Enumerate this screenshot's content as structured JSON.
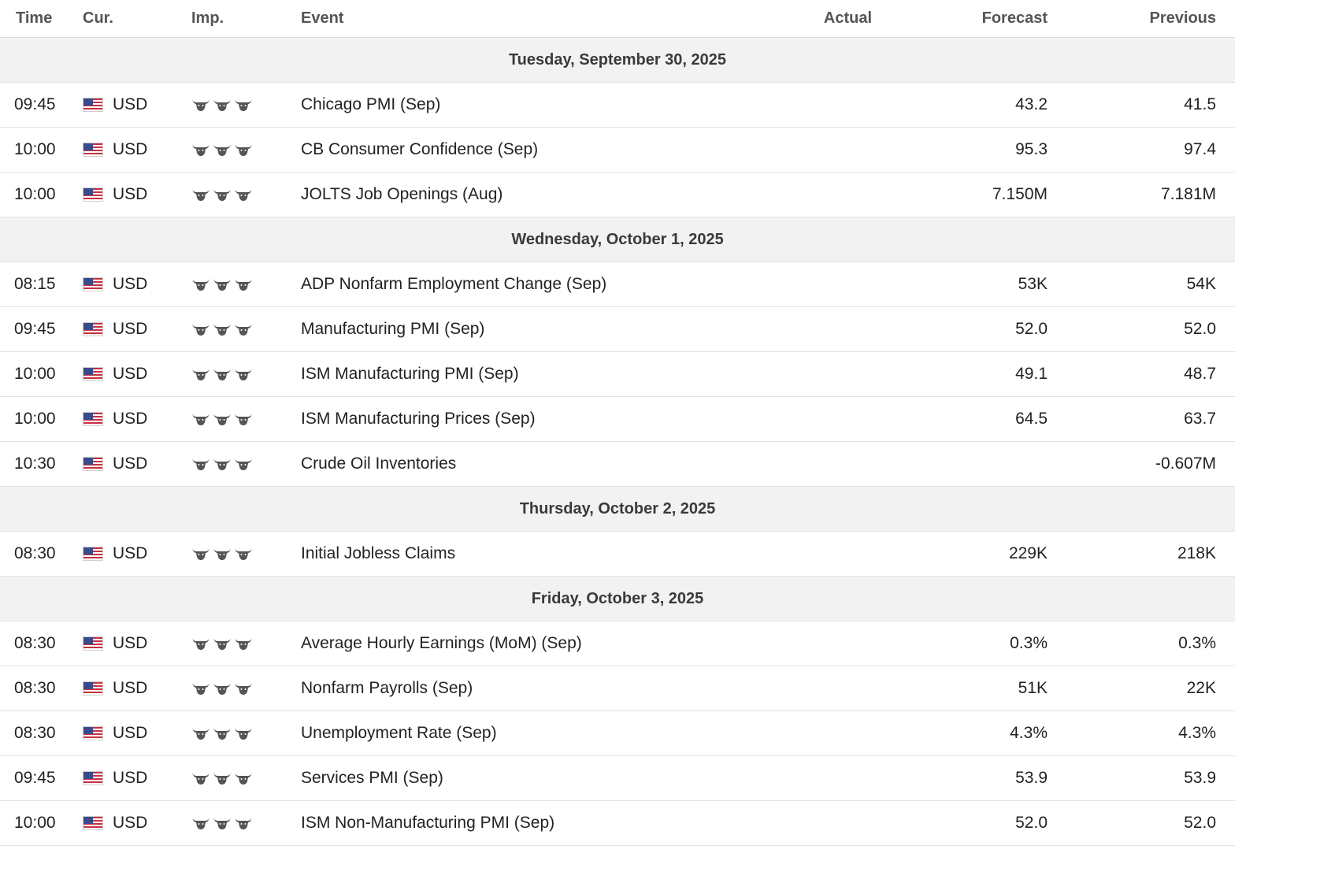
{
  "header": {
    "time": "Time",
    "currency": "Cur.",
    "importance": "Imp.",
    "event": "Event",
    "actual": "Actual",
    "forecast": "Forecast",
    "previous": "Previous"
  },
  "importance_icon": "bull-icon",
  "flag_icon": "us-flag-icon",
  "days": [
    {
      "date": "Tuesday, September 30, 2025",
      "events": [
        {
          "time": "09:45",
          "currency": "USD",
          "importance": 3,
          "event": "Chicago PMI (Sep)",
          "actual": "",
          "forecast": "43.2",
          "previous": "41.5"
        },
        {
          "time": "10:00",
          "currency": "USD",
          "importance": 3,
          "event": "CB Consumer Confidence (Sep)",
          "actual": "",
          "forecast": "95.3",
          "previous": "97.4"
        },
        {
          "time": "10:00",
          "currency": "USD",
          "importance": 3,
          "event": "JOLTS Job Openings (Aug)",
          "actual": "",
          "forecast": "7.150M",
          "previous": "7.181M"
        }
      ]
    },
    {
      "date": "Wednesday, October 1, 2025",
      "events": [
        {
          "time": "08:15",
          "currency": "USD",
          "importance": 3,
          "event": "ADP Nonfarm Employment Change (Sep)",
          "actual": "",
          "forecast": "53K",
          "previous": "54K"
        },
        {
          "time": "09:45",
          "currency": "USD",
          "importance": 3,
          "event": "Manufacturing PMI (Sep)",
          "actual": "",
          "forecast": "52.0",
          "previous": "52.0"
        },
        {
          "time": "10:00",
          "currency": "USD",
          "importance": 3,
          "event": "ISM Manufacturing PMI (Sep)",
          "actual": "",
          "forecast": "49.1",
          "previous": "48.7"
        },
        {
          "time": "10:00",
          "currency": "USD",
          "importance": 3,
          "event": "ISM Manufacturing Prices (Sep)",
          "actual": "",
          "forecast": "64.5",
          "previous": "63.7"
        },
        {
          "time": "10:30",
          "currency": "USD",
          "importance": 3,
          "event": "Crude Oil Inventories",
          "actual": "",
          "forecast": "",
          "previous": "-0.607M"
        }
      ]
    },
    {
      "date": "Thursday, October 2, 2025",
      "events": [
        {
          "time": "08:30",
          "currency": "USD",
          "importance": 3,
          "event": "Initial Jobless Claims",
          "actual": "",
          "forecast": "229K",
          "previous": "218K"
        }
      ]
    },
    {
      "date": "Friday, October 3, 2025",
      "events": [
        {
          "time": "08:30",
          "currency": "USD",
          "importance": 3,
          "event": "Average Hourly Earnings (MoM) (Sep)",
          "actual": "",
          "forecast": "0.3%",
          "previous": "0.3%"
        },
        {
          "time": "08:30",
          "currency": "USD",
          "importance": 3,
          "event": "Nonfarm Payrolls (Sep)",
          "actual": "",
          "forecast": "51K",
          "previous": "22K"
        },
        {
          "time": "08:30",
          "currency": "USD",
          "importance": 3,
          "event": "Unemployment Rate (Sep)",
          "actual": "",
          "forecast": "4.3%",
          "previous": "4.3%"
        },
        {
          "time": "09:45",
          "currency": "USD",
          "importance": 3,
          "event": "Services PMI (Sep)",
          "actual": "",
          "forecast": "53.9",
          "previous": "53.9"
        },
        {
          "time": "10:00",
          "currency": "USD",
          "importance": 3,
          "event": "ISM Non-Manufacturing PMI (Sep)",
          "actual": "",
          "forecast": "52.0",
          "previous": "52.0"
        }
      ]
    }
  ]
}
